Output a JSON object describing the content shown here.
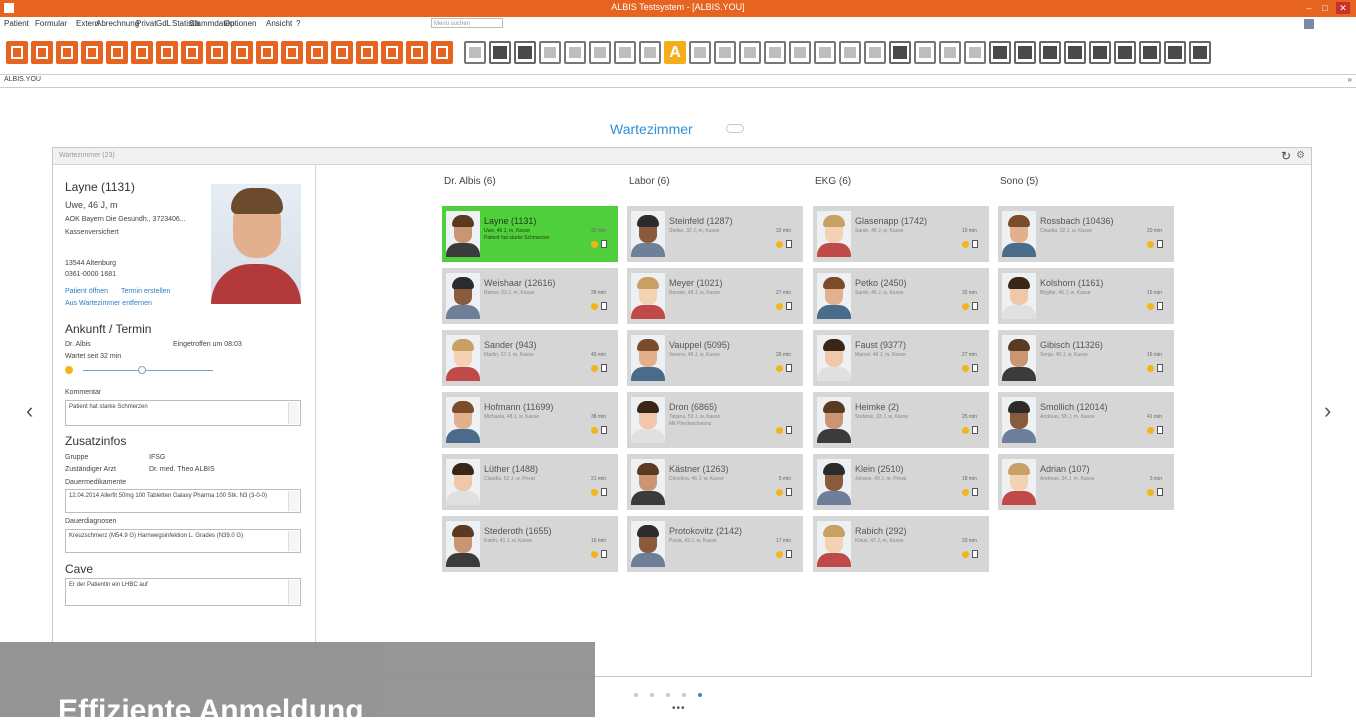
{
  "window": {
    "title": "ALBIS Testsystem - [ALBIS.YOU]"
  },
  "menu": {
    "items": [
      "Patient",
      "Formular",
      "Extern",
      "Abrechnung",
      "Privat",
      "GdL",
      "Statistik",
      "Stammdaten",
      "Optionen",
      "Ansicht",
      "?"
    ],
    "search_placeholder": "Menü suchen"
  },
  "tabstrip": {
    "tab": "ALBIS.YOU",
    "arrows": "»"
  },
  "wartezimmer": {
    "title": "Wartezimmer",
    "panel_title": "Wartezimmer (23)",
    "refresh_icon": "↻",
    "settings_icon": "⚙"
  },
  "patient": {
    "name": "Layne (1131)",
    "age_line": "Uwe, 46 J, m",
    "insurance": "AOK Bayern Die Gesundh., 3723406...",
    "status": "Kassenversichert",
    "address": "13544 Altenburg",
    "phone": "0361-0000 1681",
    "link_open": "Patient öffnen",
    "link_appointment": "Termin erstellen",
    "link_remove": "Aus Wartezimmer entfernen",
    "arrival_heading": "Ankunft / Termin",
    "doctor": "Dr. Albis",
    "arrived": "Eingetroffen um 08:03",
    "waiting": "Wartet seit 32 min",
    "comment_label": "Kommentar",
    "comment": "Patient hat starke Schmerzen",
    "extra_heading": "Zusatzinfos",
    "group_label": "Gruppe",
    "group_value": "IFSG",
    "doctor_label": "Zuständiger Arzt",
    "doctor_value": "Dr. med. Theo ALBIS",
    "meds_label": "Dauermedikamente",
    "meds_value": "12.04.2014 Allerfit 50mg 100 Tabletten Galaxy Pharma 100 Stk. N3 (3-0-0)",
    "diag_label": "Dauerdiagnosen",
    "diag_value": "Kreuzschmerz (M54.9 G) Harnwegsinfektion L. Grades (N39.0 G)",
    "cave_heading": "Cave",
    "cave_value": "Er der Patientin ein LHBC auf"
  },
  "columns": [
    {
      "header": "Dr. Albis (6)",
      "cards": [
        {
          "name": "Layne (1131)",
          "sub": "Uwe, 46 J, m, Kasse",
          "sub2": "Patient hat starke Schmerzen",
          "wait": "32 min",
          "active": true
        },
        {
          "name": "Weishaar (12616)",
          "sub": "Rainer, 53 J, m, Kasse",
          "wait": "28 min"
        },
        {
          "name": "Sander (943)",
          "sub": "Martin, 37 J, m, Kasse",
          "wait": "40 min"
        },
        {
          "name": "Hofmann (11699)",
          "sub": "Michaela, 48 J, w, Kasse",
          "wait": "38 min"
        },
        {
          "name": "Lüther (1488)",
          "sub": "Claudia, 52 J, w, Privat",
          "wait": "21 min"
        },
        {
          "name": "Stederoth (1655)",
          "sub": "Katrin, 41 J, w, Kasse",
          "wait": "16 min"
        }
      ]
    },
    {
      "header": "Labor (6)",
      "cards": [
        {
          "name": "Steinfeld (1287)",
          "sub": "Stefan, 32 J, m, Kasse",
          "wait": "32 min"
        },
        {
          "name": "Meyer (1021)",
          "sub": "Renate, 48 J, w, Kasse",
          "wait": "27 min"
        },
        {
          "name": "Vauppel (5095)",
          "sub": "Verena, 48 J, w, Kasse",
          "wait": "26 min"
        },
        {
          "name": "Dron (6865)",
          "sub": "Tatjana, 53 J, w, Kasse",
          "sub2": "Mit Pferdeschwanz",
          "wait": "",
          "active": false
        },
        {
          "name": "Kästner (1263)",
          "sub": "Christina, 46 J, w, Kasse",
          "wait": "5 min"
        },
        {
          "name": "Protokovitz (2142)",
          "sub": "Pavla, 43 J, w, Kasse",
          "wait": "17 min"
        }
      ]
    },
    {
      "header": "EKG (6)",
      "cards": [
        {
          "name": "Glasenapp (1742)",
          "sub": "Sarah, 46 J, w, Kasse",
          "wait": "19 min"
        },
        {
          "name": "Petko (2450)",
          "sub": "Sarah, 46 J, w, Kasse",
          "wait": "32 min"
        },
        {
          "name": "Faust (9377)",
          "sub": "Marcel, 48 J, m, Kasse",
          "wait": "27 min"
        },
        {
          "name": "Heimke (2)",
          "sub": "Stefanie, 33 J, w, Kasse",
          "wait": "25 min"
        },
        {
          "name": "Klein (2510)",
          "sub": "Johann, 40 J, m, Privat",
          "wait": "18 min"
        },
        {
          "name": "Rabich (292)",
          "sub": "Klaus, 47 J, m, Kasse",
          "wait": "33 min"
        }
      ]
    },
    {
      "header": "Sono (5)",
      "cards": [
        {
          "name": "Rossbach (10436)",
          "sub": "Claudia, 32 J, w, Kasse",
          "wait": "20 min"
        },
        {
          "name": "Kolshorn (1161)",
          "sub": "Birgitte, 46 J, w, Kasse",
          "wait": "15 min"
        },
        {
          "name": "Gibisch (11326)",
          "sub": "Sonja, 40 J, w, Kasse",
          "wait": "16 min"
        },
        {
          "name": "Smollich (12014)",
          "sub": "Andreas, 58 J, m, Kasse",
          "wait": "41 min"
        },
        {
          "name": "Adrian (107)",
          "sub": "Andreas, 34 J, m, Kasse",
          "wait": "3 min"
        }
      ]
    }
  ],
  "pager": {
    "dots": 5,
    "active": 4,
    "ellipsis": "•••"
  },
  "overlay": {
    "text": "Effiziente Anmeldung"
  },
  "colors": {
    "accent": "#e6641f",
    "active_card": "#4fcf3b",
    "title_blue": "#2f8fd6"
  }
}
